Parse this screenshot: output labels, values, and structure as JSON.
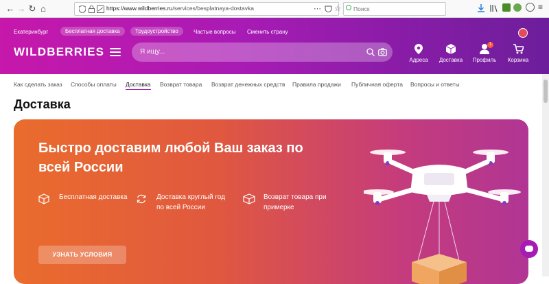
{
  "browser": {
    "url_host": "https://www.wildberries.ru",
    "url_path": "/services/besplatnaya-dostavka",
    "search_placeholder": "Поиск"
  },
  "header": {
    "city": "Екатеринбург",
    "free_delivery": "Бесплатная доставка",
    "jobs": "Трудоустройство",
    "faq": "Частые вопросы",
    "change_country": "Сменить страну",
    "logo": "WILDBERRIES",
    "search_placeholder": "Я ищу...",
    "items": {
      "addresses": "Адреса",
      "delivery": "Доставка",
      "profile": "Профиль",
      "cart": "Корзина"
    },
    "profile_badge": "1",
    "colors": {
      "gradient_start": "#c618ab",
      "gradient_end": "#6c1e9b"
    }
  },
  "subnav": {
    "items": [
      "Как сделать заказ",
      "Способы оплаты",
      "Доставка",
      "Возврат товара",
      "Возврат денежных средств",
      "Правила продажи",
      "Публичная оферта",
      "Вопросы и ответы"
    ],
    "active_index": 2
  },
  "page_title": "Доставка",
  "banner": {
    "title": "Быстро доставим любой Ваш заказ по всей России",
    "features": [
      {
        "icon": "box-icon",
        "text": "Бесплатная доставка"
      },
      {
        "icon": "refresh-icon",
        "text": "Доставка круглый год по всей России"
      },
      {
        "icon": "return-box-icon",
        "text": "Возврат товара при примерке"
      }
    ],
    "cta_label": "УЗНАТЬ УСЛОВИЯ",
    "colors": {
      "start": "#ea6c2d",
      "end": "#b03594"
    }
  }
}
